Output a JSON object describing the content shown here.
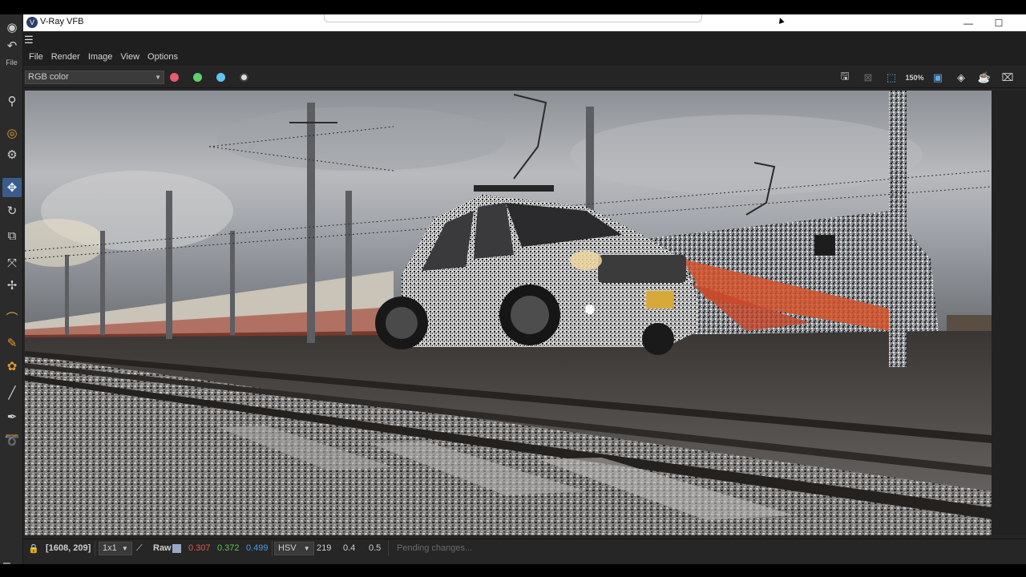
{
  "window": {
    "title": "V-Ray VFB",
    "min_symbol": "—",
    "max_symbol": "☐"
  },
  "c4d": {
    "file_label": "File"
  },
  "menu": {
    "items": [
      "File",
      "Render",
      "Image",
      "View",
      "Options"
    ]
  },
  "toolbar": {
    "channel_select": "RGB color",
    "color_dots": [
      "#e85a6e",
      "#5fd16a",
      "#5fc4ef"
    ],
    "right_icons": [
      "save-icon",
      "clear-icon",
      "region-render-icon",
      "zoom-150-icon",
      "frame-icon",
      "lens-icon",
      "teapot-icon",
      "camera-icon"
    ],
    "zoom_text": "150%"
  },
  "status": {
    "coords": "[1608, 209]",
    "sample": "1x1",
    "mode": "Raw",
    "r": "0.307",
    "g": "0.372",
    "b": "0.499",
    "colorspace": "HSV",
    "h": "219",
    "s": "0.4",
    "v": "0.5",
    "message": "Pending changes..."
  },
  "colors": {
    "r": "#e2554e",
    "g": "#59c752",
    "b": "#4b9be0",
    "accent": "#3b5c8a"
  }
}
